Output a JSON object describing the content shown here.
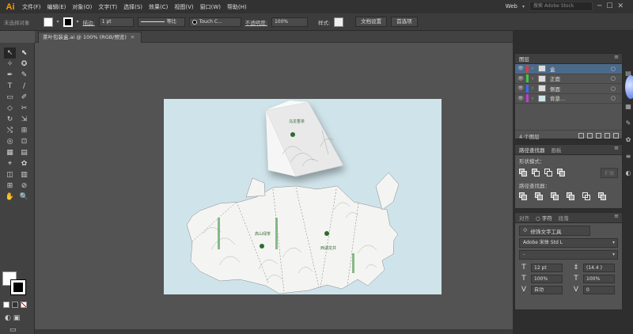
{
  "app": {
    "logo": "Ai"
  },
  "menu": [
    "文件(F)",
    "编辑(E)",
    "对象(O)",
    "文字(T)",
    "选择(S)",
    "效果(C)",
    "视图(V)",
    "窗口(W)",
    "帮助(H)"
  ],
  "workspace": "Web",
  "search": {
    "placeholder": "搜索 Adobe Stock"
  },
  "control_bar": {
    "no_selection": "未选择对象",
    "stroke_label": "描边:",
    "stroke_value": "1 pt",
    "uniform_label": "等比",
    "brush_label": "Touch C...",
    "opacity_label": "不透明度:",
    "opacity_value": "100%",
    "style_label": "样式:",
    "doc_setup": "文档设置",
    "preferences": "首选项"
  },
  "document_tab": {
    "title": "茶叶包装盒.ai @ 100% (RGB/预览)"
  },
  "tools": [
    "↖",
    "⬉",
    "✧",
    "✪",
    "✒",
    "✎",
    "T",
    "/",
    "▭",
    "✐",
    "◇",
    "✂",
    "↻",
    "⇲",
    "⤭",
    "⊞",
    "◎",
    "⊡",
    "▦",
    "▤",
    "⌖",
    "✿",
    "◫",
    "▥",
    "⊞",
    "⊘",
    "✋",
    "🔍"
  ],
  "colors": {
    "fill": "#ffffff",
    "stroke": "#000000",
    "layer_selected": "#4b6a8a",
    "artboard": "#cfe4ea"
  },
  "layers_panel": {
    "title": "图层",
    "layers": [
      {
        "name": "盒",
        "color": "#e03c3c",
        "selected": true
      },
      {
        "name": "正面",
        "color": "#3ec84a",
        "selected": false
      },
      {
        "name": "侧面",
        "color": "#3c6cf0",
        "selected": false
      },
      {
        "name": "背景...",
        "color": "#c23cd6",
        "selected": false
      }
    ],
    "footer": "4 个图层"
  },
  "pathfinder_panel": {
    "tabs": [
      "路径查找器",
      "画板"
    ],
    "shape_modes_label": "形状模式：",
    "expand_label": "扩展",
    "pathfinders_label": "路径查找器："
  },
  "character_panel": {
    "tabs": [
      "对齐",
      "○ 字符",
      "段落"
    ],
    "touch_type": "修饰文字工具",
    "font_family": "Adobe 宋体 Std L",
    "font_style": "-",
    "size": "12 pt",
    "leading": "(14.4 )",
    "vscale": "100%",
    "hscale": "100%",
    "kerning": "自动",
    "tracking": "0"
  },
  "artwork": {
    "brand_text": "乌龙香茶",
    "brand_text_2": "高山绿茶",
    "brand_text_3": "西湖龙井"
  }
}
